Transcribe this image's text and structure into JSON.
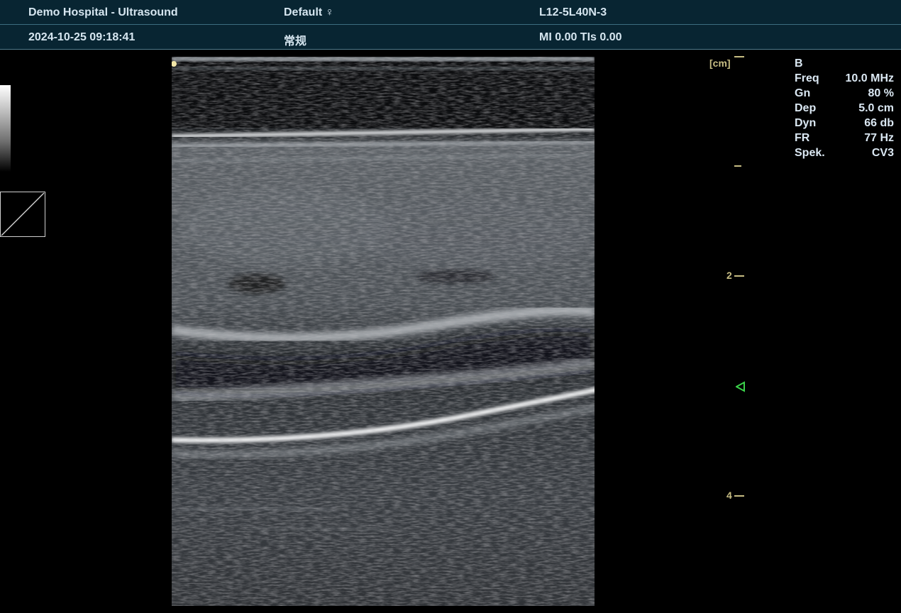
{
  "header": {
    "hospital": "Demo Hospital - Ultrasound",
    "preset": "Default ♀",
    "probe": "L12-5L40N-3",
    "datetime": "2024-10-25 09:18:41",
    "exam_type": "常规",
    "indices": "MI 0.00 TIs 0.00"
  },
  "scale": {
    "unit": "[cm]",
    "labels": [
      "2",
      "4"
    ]
  },
  "params": {
    "mode": "B",
    "rows": [
      {
        "key": "Freq",
        "value": "10.0 MHz"
      },
      {
        "key": "Gn",
        "value": "80 %"
      },
      {
        "key": "Dep",
        "value": "5.0 cm"
      },
      {
        "key": "Dyn",
        "value": "66 db"
      },
      {
        "key": "FR",
        "value": "77 Hz"
      },
      {
        "key": "Spek.",
        "value": "CV3"
      }
    ]
  },
  "colors": {
    "header_bg": "#082532",
    "scale": "#c7bd83",
    "focus_marker": "#3bd24a"
  }
}
